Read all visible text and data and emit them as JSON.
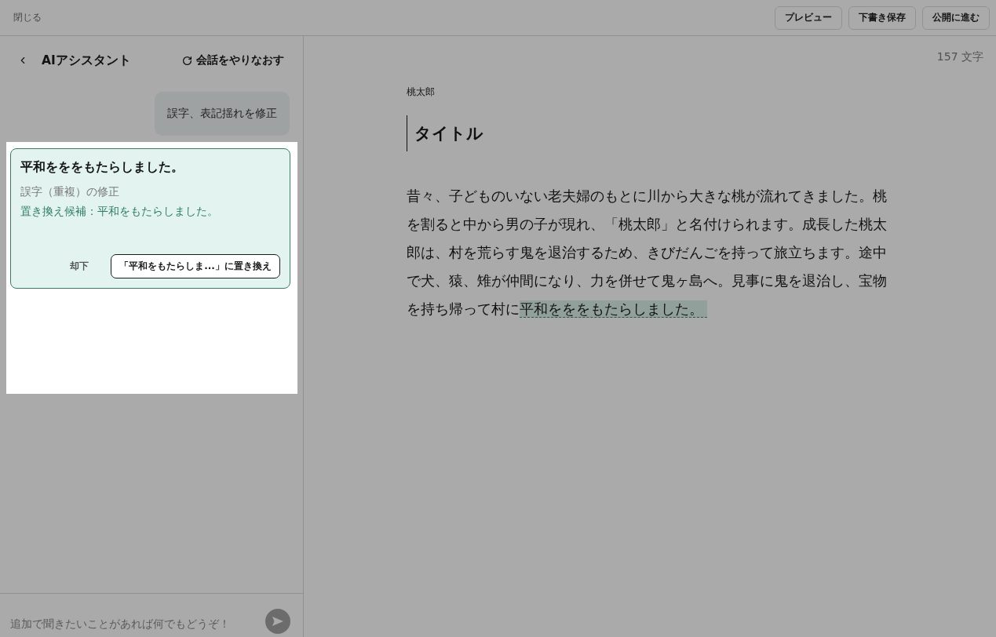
{
  "top_bar": {
    "close": "閉じる",
    "buttons": [
      "プレビュー",
      "下書き保存",
      "公開に進む"
    ]
  },
  "assistant": {
    "title": "AIアシスタント",
    "restart": "会話をやりなおす",
    "messages": [
      {
        "kind": "user",
        "text": "誤字、表記揺れを修正"
      }
    ],
    "suggestion": {
      "original": "平和をををもたらしました。",
      "category": "誤字（重複）の修正",
      "candidate": "置き換え候補：平和をもたらしました。",
      "dismiss": "却下",
      "replace": "「平和をもたらしま...」に置き換え"
    },
    "input": {
      "placeholder": "追加で聞きたいことがあれば何でもどうぞ！"
    }
  },
  "editor": {
    "char_count": "157 文字",
    "label": "桃太郎",
    "title": "タイトル",
    "body": [
      {
        "kind": "text",
        "text": "昔々、子どものいない老夫婦のもとに川から大きな桃が流れてきました。桃を割ると中から男の子が現れ、「桃太郎」と名付けられます。成長した桃太郎は、村を荒らす鬼を退治するため、きびだんごを持って旅立ちます。途中で犬、猿、雉が仲間になり、力を併せて鬼ヶ島へ。見事に鬼を退治し、宝物を持ち帰って村に"
      },
      {
        "kind": "flagged",
        "text": "平和をををもたらしました。"
      }
    ]
  }
}
